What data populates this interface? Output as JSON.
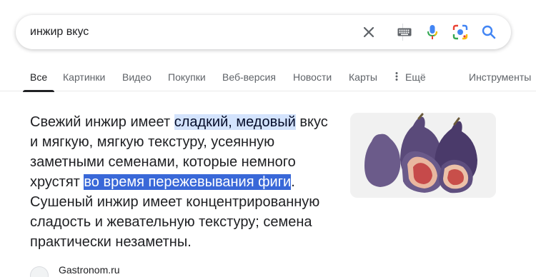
{
  "search": {
    "query": "инжир вкус"
  },
  "tabs": [
    {
      "label": "Все",
      "active": true
    },
    {
      "label": "Картинки"
    },
    {
      "label": "Видео"
    },
    {
      "label": "Покупки"
    },
    {
      "label": "Веб-версия"
    },
    {
      "label": "Новости"
    },
    {
      "label": "Карты"
    },
    {
      "label": "Ещё"
    }
  ],
  "tools_label": "Инструменты",
  "answer": {
    "part1": "Свежий инжир имеет ",
    "highlight1": "сладкий, медовый",
    "part2": " вкус и мягкую, мягкую текстуру, усеянную заметными семенами, которые немного хрустят ",
    "highlight2": "во время пережевывания фиги",
    "part3": ". Сушеный инжир имеет концентрированную сладость и жевательную текстуру; семена практически незаметны."
  },
  "source": {
    "name": "Gastronom.ru"
  },
  "colors": {
    "google_blue": "#4285f4",
    "google_red": "#ea4335",
    "google_yellow": "#fbbc04",
    "google_green": "#34a853",
    "highlight_light": "#d3e3fd",
    "highlight_dark": "#3968d8"
  },
  "icons": [
    "clear-icon",
    "keyboard-icon",
    "microphone-icon",
    "google-lens-icon",
    "search-icon",
    "more-dots-icon"
  ]
}
